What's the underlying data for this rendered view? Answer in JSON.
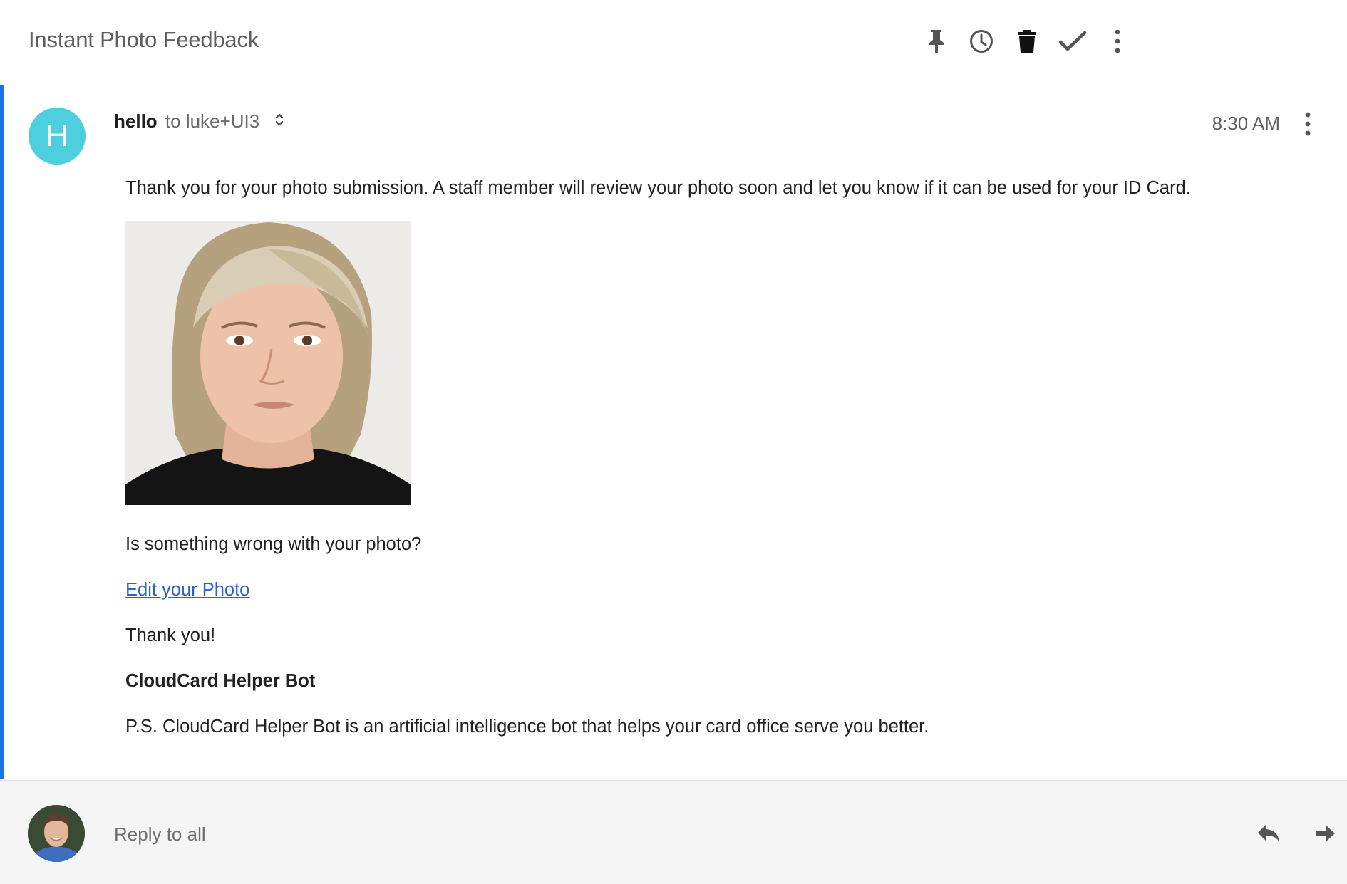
{
  "header": {
    "subject": "Instant Photo Feedback",
    "actions": [
      {
        "name": "pin-icon"
      },
      {
        "name": "snooze-clock-icon"
      },
      {
        "name": "trash-icon"
      },
      {
        "name": "done-check-icon"
      },
      {
        "name": "more-vertical-icon"
      }
    ]
  },
  "message": {
    "sender_initial": "H",
    "sender_name": "hello",
    "recipient": "to luke+UI3",
    "time": "8:30 AM",
    "body": {
      "intro": "Thank you for your photo submission. A staff member will review your photo soon and let you know if it can be used for your ID Card.",
      "question": "Is something wrong with your photo?",
      "link_text": "Edit your Photo",
      "thanks": "Thank you!",
      "signature": "CloudCard Helper Bot",
      "ps": "P.S. CloudCard Helper Bot is an artificial intelligence bot that helps your card office serve you better."
    }
  },
  "reply": {
    "placeholder": "Reply to all"
  },
  "colors": {
    "accent": "#1a73e8",
    "avatar": "#4ecfe0",
    "link": "#2962cc"
  }
}
